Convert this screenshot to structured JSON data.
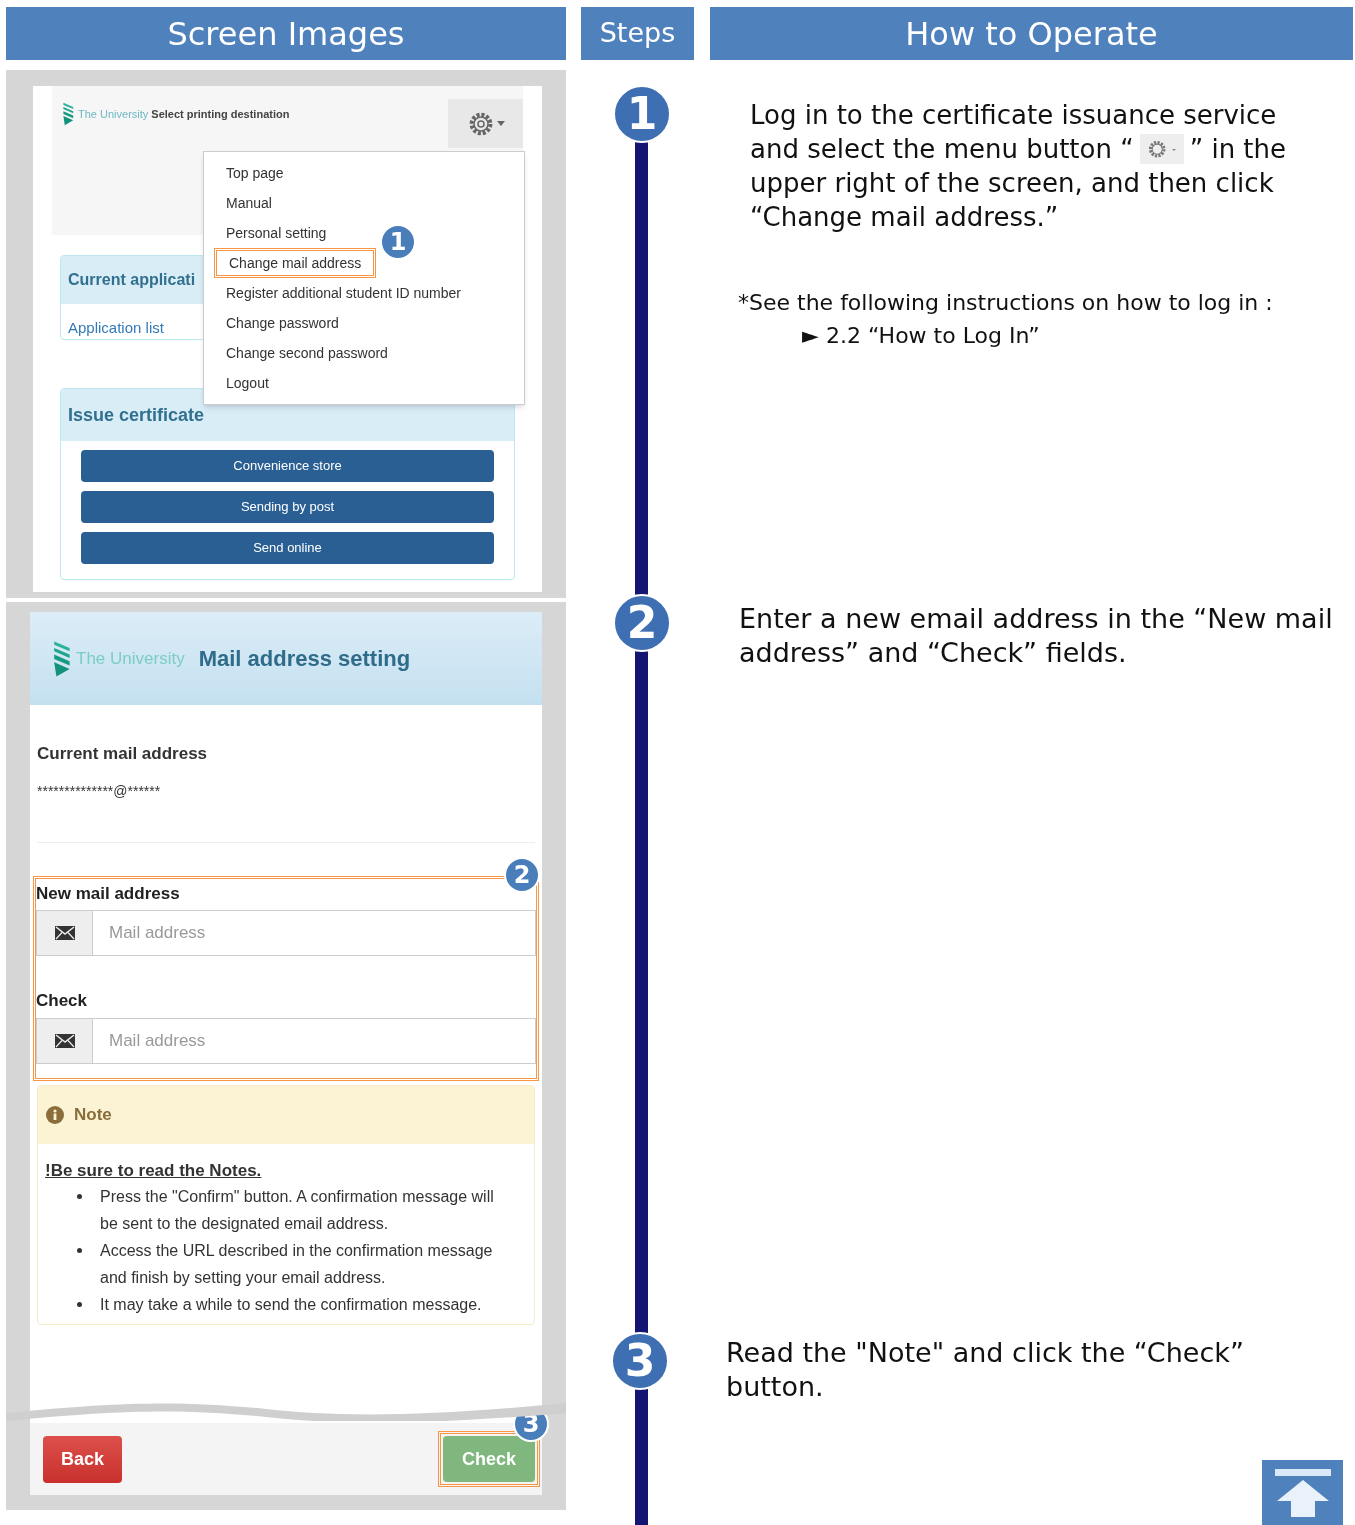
{
  "headers": [
    "Screen Images",
    "Steps",
    "How to Operate"
  ],
  "screen_1": {
    "logo_text": "The University",
    "page_title": "Select printing destination",
    "menu_items": [
      {
        "label": "Top page",
        "selected": false
      },
      {
        "label": "Manual",
        "selected": false
      },
      {
        "label": "Personal setting",
        "selected": false
      },
      {
        "label": "Change mail address",
        "selected": true
      },
      {
        "label": "Register additional student ID number",
        "selected": false
      },
      {
        "label": "Change password",
        "selected": false
      },
      {
        "label": "Change second password",
        "selected": false
      },
      {
        "label": "Logout",
        "selected": false
      }
    ],
    "callout": "1",
    "section_1_title": "Current applicati",
    "section_1_link": "Application list",
    "section_2_title": "Issue certificate",
    "buttons": [
      "Convenience store",
      "Sending by post",
      "Send online"
    ]
  },
  "screen_2": {
    "logo_text": "The University",
    "title": "Mail address setting",
    "current_label": "Current mail address",
    "current_value": "**************@******",
    "fields": [
      {
        "label": "New mail address",
        "placeholder": "Mail address"
      },
      {
        "label": "Check",
        "placeholder": "Mail address"
      }
    ],
    "callout_fields": "2",
    "note": {
      "title": "Note",
      "heading": "!Be sure to read the Notes.",
      "items": [
        "Press the \"Confirm\" button. A confirmation message will be sent to the designated email address.",
        "Access the URL described in the confirmation message and finish by setting your email address.",
        "It may take a while to send the confirmation message."
      ]
    },
    "back_button": "Back",
    "check_button": "Check",
    "callout_check": "3"
  },
  "steps": [
    {
      "number": "1",
      "lines": [
        {
          "kind": "plain",
          "text": "Log in to the certificate issuance service"
        },
        {
          "kind": "with_button",
          "text": "and select the menu button “",
          "text_after": "” in the"
        },
        {
          "kind": "plain",
          "text": "upper right of the screen, and then click"
        },
        {
          "kind": "plain",
          "text": "“Change mail address.”"
        }
      ],
      "note": "*See the following instructions on how to log in :",
      "link": "► 2.2 “How to Log In”"
    },
    {
      "number": "2",
      "text": "Enter a new email address in the “New mail address” and “Check” fields."
    },
    {
      "number": "3",
      "text": "Read the \"Note\" and click the “Check” button."
    }
  ]
}
